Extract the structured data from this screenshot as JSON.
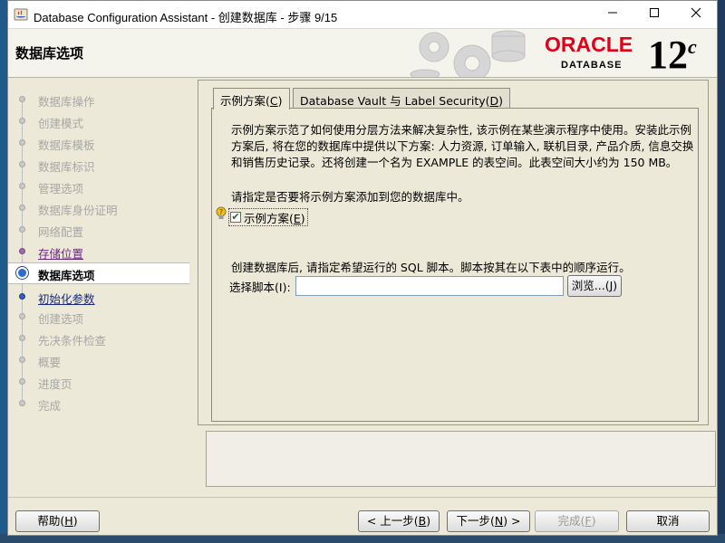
{
  "window": {
    "title": "Database Configuration Assistant - 创建数据库 - 步骤 9/15",
    "minimize_icon": "minimize-icon",
    "maximize_icon": "maximize-icon",
    "close_icon": "close-icon"
  },
  "header": {
    "page_title": "数据库选项",
    "brand_oracle": "ORACLE",
    "brand_database": "DATABASE",
    "brand_version": "12",
    "brand_version_suffix": "c"
  },
  "nav": {
    "items": [
      {
        "label": "数据库操作",
        "state": "disabled"
      },
      {
        "label": "创建模式",
        "state": "disabled"
      },
      {
        "label": "数据库模板",
        "state": "disabled"
      },
      {
        "label": "数据库标识",
        "state": "disabled"
      },
      {
        "label": "管理选项",
        "state": "disabled"
      },
      {
        "label": "数据库身份证明",
        "state": "disabled"
      },
      {
        "label": "网络配置",
        "state": "disabled"
      },
      {
        "label": "存储位置",
        "state": "visited"
      },
      {
        "label": "数据库选项",
        "state": "current"
      },
      {
        "label": "初始化参数",
        "state": "link"
      },
      {
        "label": "创建选项",
        "state": "disabled"
      },
      {
        "label": "先决条件检查",
        "state": "disabled"
      },
      {
        "label": "概要",
        "state": "disabled"
      },
      {
        "label": "进度页",
        "state": "disabled"
      },
      {
        "label": "完成",
        "state": "disabled"
      }
    ]
  },
  "tabs": [
    {
      "label": "示例方案(C)",
      "active": true
    },
    {
      "label": "Database Vault 与 Label Security(D)",
      "active": false
    }
  ],
  "sample_schema": {
    "description": "示例方案示范了如何使用分层方法来解决复杂性, 该示例在某些演示程序中使用。安装此示例方案后, 将在您的数据库中提供以下方案: 人力资源, 订单输入, 联机目录, 产品介质, 信息交换和销售历史记录。还将创建一个名为 EXAMPLE 的表空间。此表空间大小约为 150 MB。",
    "prompt": "请指定是否要将示例方案添加到您的数据库中。",
    "checkbox_label": "示例方案(E)",
    "checkbox_checked": true,
    "after_create_text": "创建数据库后, 请指定希望运行的 SQL 脚本。脚本按其在以下表中的顺序运行。",
    "script_label": "选择脚本(I):",
    "script_value": "",
    "browse_label": "浏览...(J)"
  },
  "footer": {
    "help": "帮助(H)",
    "back": "< 上一步(B)",
    "next": "下一步(N) >",
    "finish": "完成(F)",
    "cancel": "取消"
  }
}
